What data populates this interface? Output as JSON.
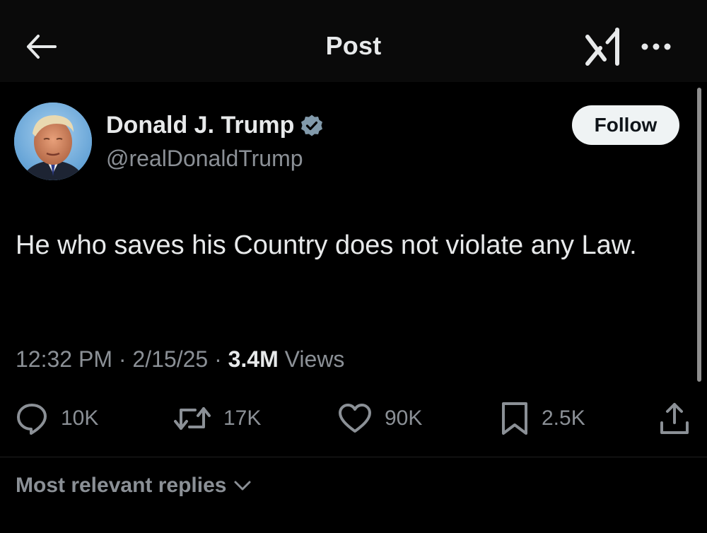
{
  "header": {
    "title": "Post",
    "back_icon": "arrow-left-icon",
    "grok_icon": "grok-icon",
    "more_icon": "more-horizontal-icon"
  },
  "post": {
    "author": {
      "name": "Donald J. Trump",
      "handle": "@realDonaldTrump",
      "verified": true,
      "verified_color": "#829aab"
    },
    "follow_label": "Follow",
    "text": "He who saves his Country does not violate any Law.",
    "time": "12:32 PM",
    "separator1": " · ",
    "date": "2/15/25",
    "separator2": " · ",
    "views_count": "3.4M",
    "views_label": " Views"
  },
  "actions": {
    "replies": "10K",
    "reposts": "17K",
    "likes": "90K",
    "bookmarks": "2.5K"
  },
  "replies_sort": {
    "label": "Most relevant replies"
  },
  "colors": {
    "background": "#000000",
    "topbar": "#0a0a0a",
    "text_primary": "#e7e9ea",
    "text_secondary": "#8b9096",
    "follow_bg": "#eff3f4"
  }
}
